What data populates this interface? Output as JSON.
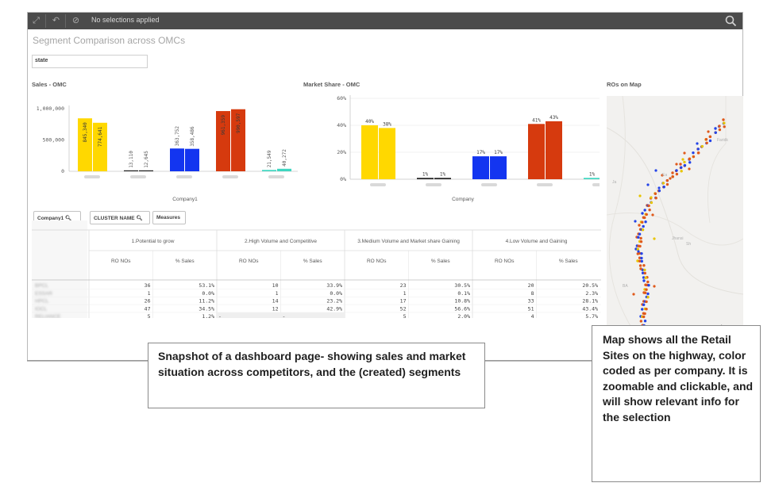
{
  "toolbar": {
    "selection_text": "No selections applied"
  },
  "sheet": {
    "title": "Segment Comparison across OMCs"
  },
  "filter": {
    "label": "state"
  },
  "sales_chart": {
    "title": "Sales - OMC",
    "xlabel": "Company1",
    "y_ticks": [
      "1,000,000",
      "500,000",
      "0"
    ]
  },
  "share_chart": {
    "title": "Market Share - OMC",
    "xlabel": "Company",
    "y_ticks": [
      "60%",
      "40%",
      "20%",
      "0%"
    ]
  },
  "map_panel": {
    "title": "ROs on Map"
  },
  "chart_data": [
    {
      "type": "bar",
      "title": "Sales - OMC",
      "xlabel": "Company1",
      "ylabel": "",
      "ylim": [
        0,
        1000000
      ],
      "grid": false,
      "categories": [
        "",
        "",
        "",
        "",
        ""
      ],
      "series": [
        {
          "values": [
            845340,
            13110,
            363752,
            961359,
            21549
          ],
          "labels": [
            "845,340",
            "13,110",
            "363,752",
            "961,359",
            "21,549"
          ]
        },
        {
          "values": [
            774641,
            12645,
            358486,
            990597,
            40272
          ],
          "labels": [
            "774,641",
            "12,645",
            "358,486",
            "990,597",
            "40,272"
          ]
        }
      ],
      "colors": [
        "#ffd800",
        "#222222",
        "#1335f0",
        "#d63a0e",
        "#3fd6c0"
      ]
    },
    {
      "type": "bar",
      "title": "Market Share - OMC",
      "xlabel": "Company",
      "ylabel": "",
      "ylim": [
        0,
        60
      ],
      "grid": true,
      "categories": [
        "",
        "",
        "",
        "",
        ""
      ],
      "series": [
        {
          "values": [
            40,
            1,
            17,
            41,
            1
          ],
          "labels": [
            "40%",
            "1%",
            "17%",
            "41%",
            "1%"
          ]
        },
        {
          "values": [
            38,
            1,
            17,
            43,
            2
          ],
          "labels": [
            "38%",
            "1%",
            "17%",
            "43%",
            "2%"
          ]
        }
      ],
      "colors": [
        "#ffd800",
        "#222222",
        "#1335f0",
        "#d63a0e",
        "#3fd6c0"
      ]
    }
  ],
  "table": {
    "dim_buttons": [
      "Company1",
      "CLUSTER NAME",
      "Measures"
    ],
    "clusters": [
      "1.Potential to grow",
      "2.High Volume and Competitive",
      "3.Medium Volume and Market share Gaining",
      "4.Low Volume and Gaining"
    ],
    "measures": [
      "RO NOs",
      "% Sales"
    ],
    "rows": [
      {
        "company": "BPCL",
        "cells": [
          "36",
          "53.1%",
          "10",
          "33.9%",
          "23",
          "30.5%",
          "20",
          "20.5%"
        ]
      },
      {
        "company": "ESSAR",
        "cells": [
          "1",
          "0.0%",
          "1",
          "0.0%",
          "1",
          "0.1%",
          "8",
          "2.3%"
        ]
      },
      {
        "company": "HPCL",
        "cells": [
          "26",
          "11.2%",
          "14",
          "23.2%",
          "17",
          "10.8%",
          "33",
          "28.1%"
        ]
      },
      {
        "company": "IOCL",
        "cells": [
          "47",
          "34.5%",
          "12",
          "42.9%",
          "52",
          "56.6%",
          "51",
          "43.4%"
        ]
      },
      {
        "company": "RELIANCE",
        "cells": [
          "5",
          "1.2%",
          "-",
          "-",
          "5",
          "2.0%",
          "4",
          "5.7%"
        ]
      }
    ]
  },
  "map_labels": [
    "Faridk",
    "Ea",
    "Ja",
    "Jhansi",
    "Sh",
    "BA",
    "A"
  ],
  "callouts": {
    "left": "Snapshot of a dashboard page- showing sales and market situation across competitors, and the (created) segments",
    "right": "Map shows all the Retail Sites on the highway, color coded as per company. It is zoomable and clickable, and will show relevant info for the selection"
  }
}
